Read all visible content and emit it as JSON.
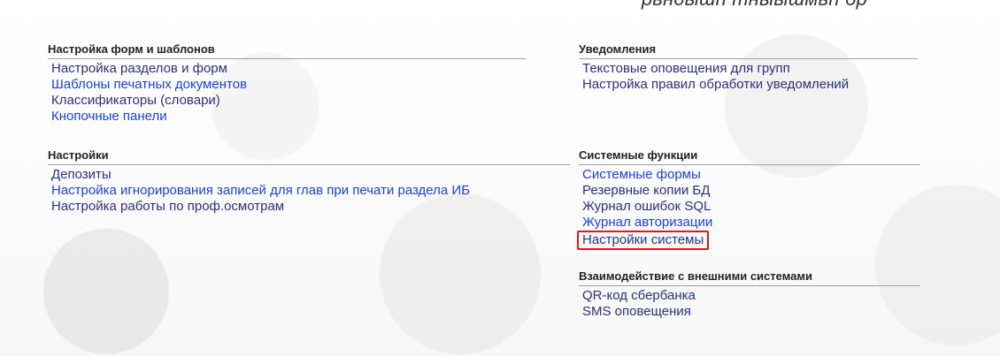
{
  "top": {
    "partial_text": "рвндышп тныышмьп бр"
  },
  "sections": {
    "forms": {
      "title": "Настройка форм и шаблонов",
      "items": [
        "Настройка разделов и форм",
        "Шаблоны печатных документов",
        "Классификаторы (словари)",
        "Кнопочные панели"
      ]
    },
    "settings": {
      "title": "Настройки",
      "items": [
        "Депозиты",
        "Настройка игнорирования записей для глав при печати раздела ИБ",
        "Настройка работы по проф.осмотрам"
      ]
    },
    "notifications": {
      "title": "Уведомления",
      "items": [
        "Текстовые оповещения для групп",
        "Настройка правил обработки уведомлений"
      ]
    },
    "system": {
      "title": "Системные функции",
      "items": [
        "Системные формы",
        "Резервные копии БД",
        "Журнал ошибок SQL",
        "Журнал авторизации",
        "Настройки системы"
      ]
    },
    "external": {
      "title": "Взаимодействие с внешними системами",
      "items": [
        "QR-код сбербанка",
        "SMS оповещения"
      ]
    }
  },
  "colors": {
    "link_blue": "#1a3fd6",
    "link_dark": "#2b2f7a",
    "highlight_border": "#e01717"
  }
}
